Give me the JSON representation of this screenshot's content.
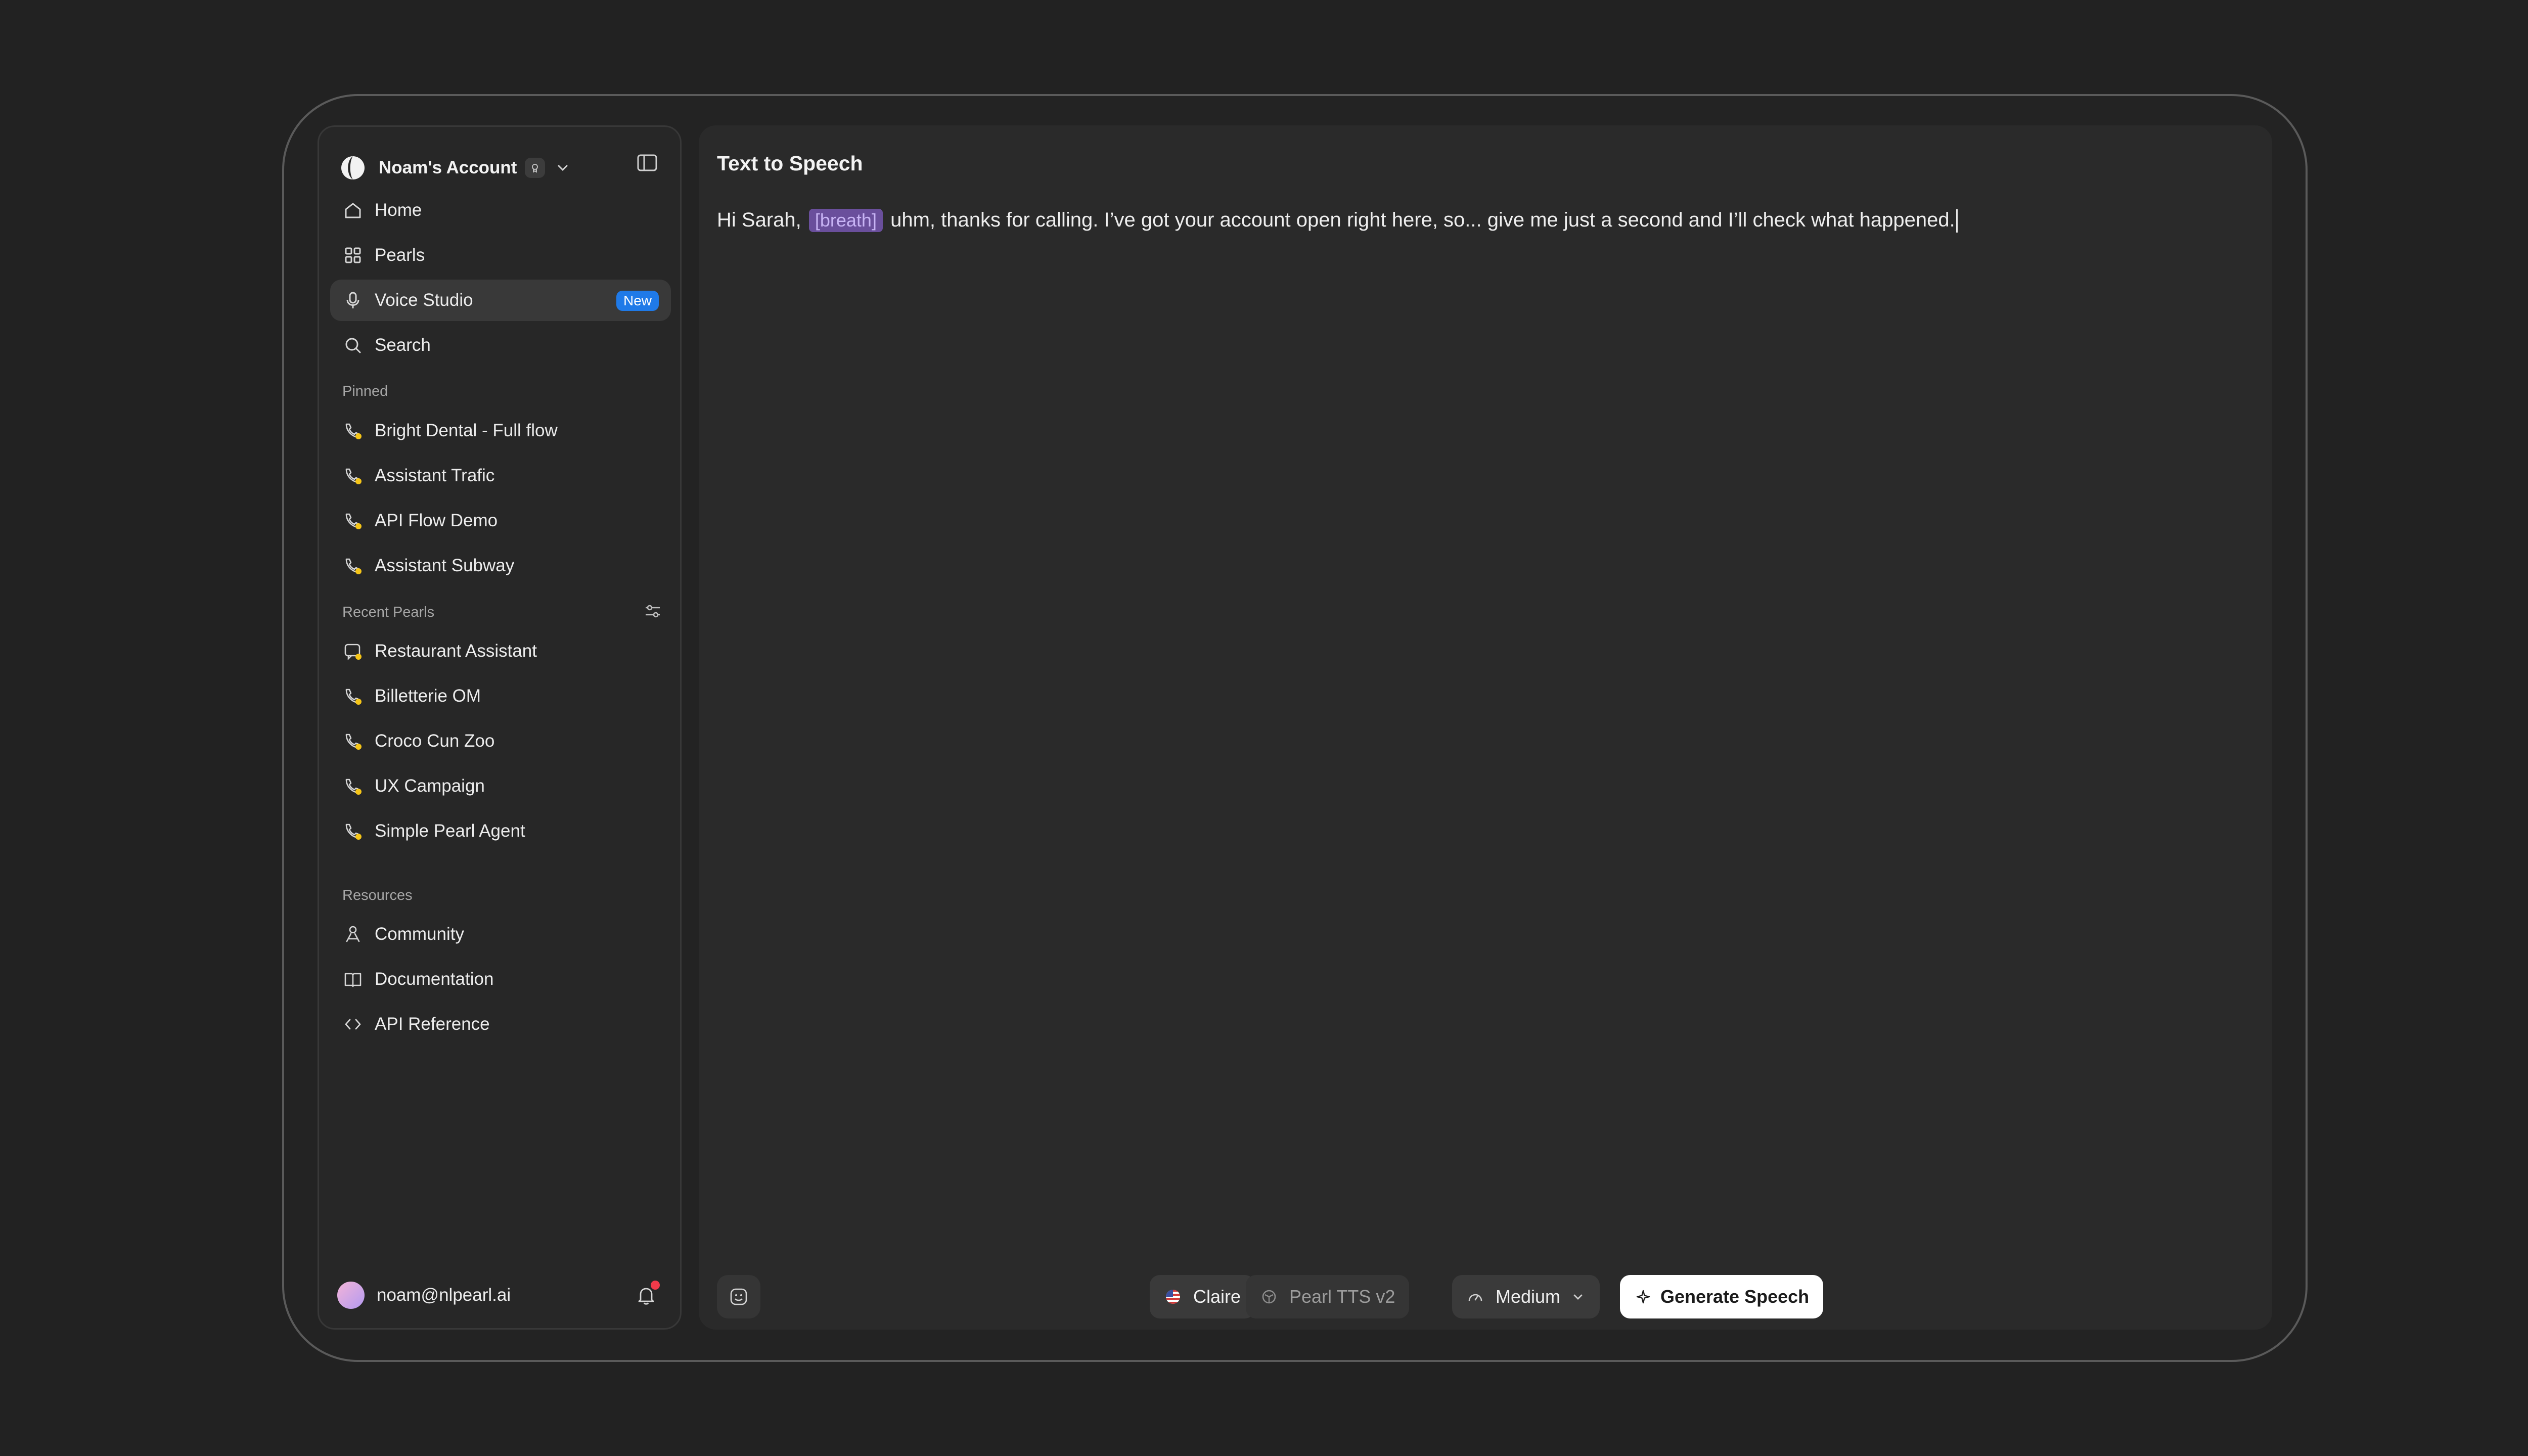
{
  "account": {
    "name": "Noam's Account"
  },
  "nav": [
    {
      "label": "Home",
      "icon": "home-icon"
    },
    {
      "label": "Pearls",
      "icon": "grid-icon"
    },
    {
      "label": "Voice Studio",
      "icon": "microphone-icon",
      "badge": "New",
      "active": true
    },
    {
      "label": "Search",
      "icon": "search-icon"
    }
  ],
  "pinned": {
    "label": "Pinned",
    "items": [
      "Bright Dental - Full flow",
      "Assistant Trafic",
      "API Flow Demo",
      "Assistant Subway"
    ]
  },
  "recent": {
    "label": "Recent Pearls",
    "items": [
      "Restaurant Assistant",
      "Billetterie OM",
      "Croco Cun Zoo",
      "UX Campaign",
      "Simple Pearl Agent"
    ]
  },
  "resources": {
    "label": "Resources",
    "items": [
      "Community",
      "Documentation",
      "API Reference"
    ]
  },
  "user": {
    "email": "noam@nlpearl.ai"
  },
  "main": {
    "title": "Text to Speech",
    "text_before": "Hi Sarah,",
    "tag": "[breath]",
    "text_after": "uhm, thanks for calling. I’ve got your account open right here, so... give me just a second and I’ll check what happened."
  },
  "toolbar": {
    "voice": "Claire",
    "model": "Pearl TTS v2",
    "speed": "Medium",
    "generate": "Generate Speech"
  },
  "colors": {
    "accent": "#1f7ae8",
    "tag_bg": "#6a4f9c",
    "status_dot": "#f5c518"
  }
}
